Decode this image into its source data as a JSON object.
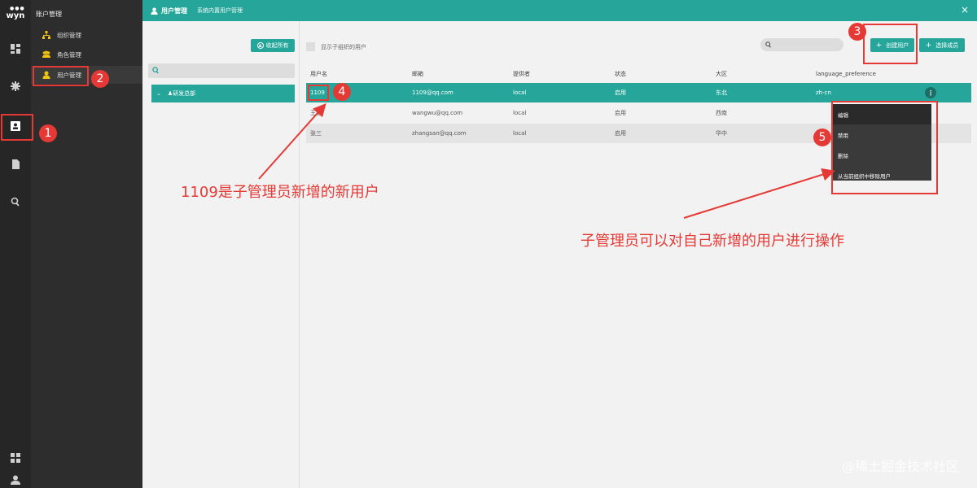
{
  "app": {
    "logo": "wyn"
  },
  "rail": {
    "icons": [
      "dashboard-icon",
      "settings-icon",
      "user-card-icon",
      "document-icon",
      "search-icon",
      "grid-icon",
      "person-icon"
    ]
  },
  "subnav": {
    "title": "账户管理",
    "items": [
      {
        "label": "组织管理",
        "icon": "org-icon"
      },
      {
        "label": "角色管理",
        "icon": "group-icon"
      },
      {
        "label": "用户管理",
        "icon": "user-icon"
      }
    ]
  },
  "header": {
    "title": "用户管理",
    "crumb": "系统内置用户管理",
    "close": "×"
  },
  "org": {
    "collapse_label": "收起所有",
    "node_label": "研发总部"
  },
  "toolbar": {
    "show_sub_label": "显示子组织的用户",
    "create_label": "创建用户",
    "select_label": "选择成员"
  },
  "table": {
    "columns": [
      "用户名",
      "邮箱",
      "提供者",
      "状态",
      "大区",
      "language_preference"
    ],
    "rows": [
      [
        "1109",
        "1109@qq.com",
        "local",
        "启用",
        "东北",
        "zh-cn"
      ],
      [
        "王五",
        "wangwu@qq.com",
        "local",
        "启用",
        "西南",
        ""
      ],
      [
        "张三",
        "zhangsan@qq.com",
        "local",
        "启用",
        "华中",
        ""
      ]
    ],
    "kebab": "⋮"
  },
  "context_menu": {
    "items": [
      "编辑",
      "禁用",
      "删除",
      "从当前组织中移除用户"
    ]
  },
  "annotations": {
    "badges": [
      "1",
      "2",
      "3",
      "4",
      "5"
    ],
    "text1": "1109是子管理员新增的新用户",
    "text2": "子管理员可以对自己新增的用户进行操作"
  },
  "watermark": "@稀土掘金技术社区",
  "colors": {
    "accent": "#26a69a",
    "annotation": "#e53935",
    "rail": "#262626",
    "subnav": "#2d2d2d"
  }
}
